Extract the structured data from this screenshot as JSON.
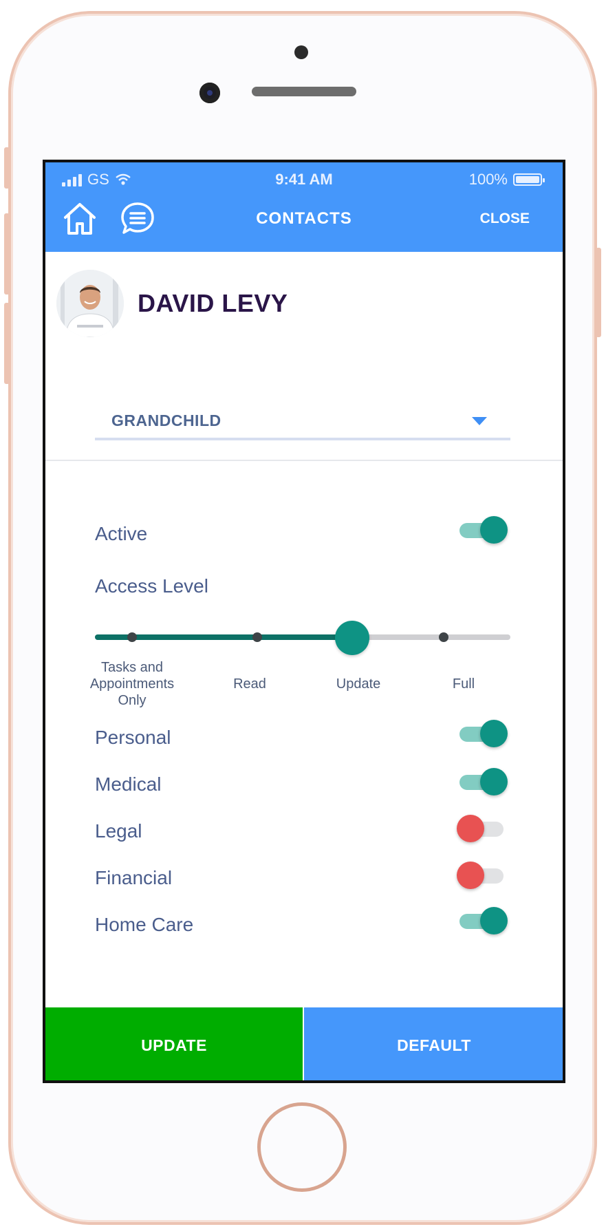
{
  "status_bar": {
    "carrier": "GS",
    "time": "9:41 AM",
    "battery": "100%"
  },
  "header": {
    "title": "CONTACTS",
    "close_label": "CLOSE"
  },
  "contact": {
    "name": "DAVID LEVY"
  },
  "relationship": {
    "selected": "GRANDCHILD"
  },
  "permissions": {
    "active": {
      "label": "Active",
      "on": true
    },
    "access_level": {
      "label": "Access Level",
      "levels": [
        "Tasks and Appointments Only",
        "Read",
        "Update",
        "Full"
      ],
      "selected": "Update"
    },
    "categories": [
      {
        "label": "Personal",
        "on": true
      },
      {
        "label": "Medical",
        "on": true
      },
      {
        "label": "Legal",
        "on": false
      },
      {
        "label": "Financial",
        "on": false
      },
      {
        "label": "Home Care",
        "on": true
      }
    ]
  },
  "actions": {
    "update_label": "UPDATE",
    "default_label": "DEFAULT"
  },
  "colors": {
    "header_blue": "#4597fb",
    "toggle_on": "#0e9384",
    "toggle_off": "#e85252",
    "update_green": "#00ad00",
    "name_purple": "#2a1548"
  },
  "icons": [
    "home-icon",
    "chat-icon",
    "wifi-icon",
    "signal-icon",
    "battery-icon",
    "dropdown-caret-icon"
  ]
}
